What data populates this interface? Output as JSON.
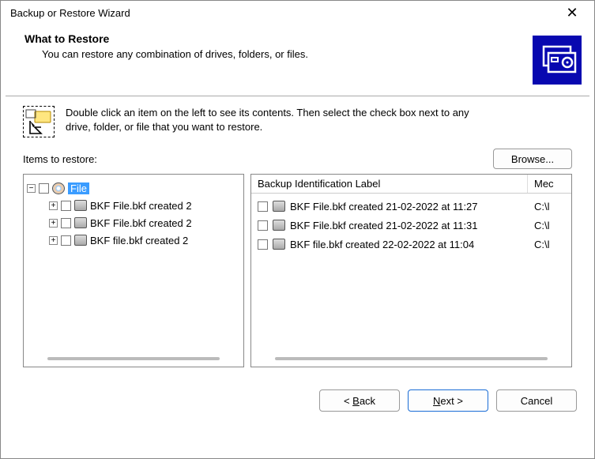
{
  "window": {
    "title": "Backup or Restore Wizard"
  },
  "header": {
    "title": "What to Restore",
    "subtitle": "You can restore any combination of drives, folders, or files."
  },
  "instruction": {
    "text": "Double click an item on the left to see its contents. Then select the check box next to any drive, folder, or file that you want to restore."
  },
  "items_label": "Items to restore:",
  "browse_label": "Browse...",
  "tree": {
    "root": {
      "label": "File",
      "expanded": true,
      "icon": "cd"
    },
    "children": [
      {
        "expand": "+",
        "label": "BKF File.bkf created 2"
      },
      {
        "expand": "+",
        "label": "BKF File.bkf created 2"
      },
      {
        "expand": "+",
        "label": "BKF file.bkf created 2"
      }
    ]
  },
  "list": {
    "columns": {
      "c1": "Backup Identification Label",
      "c2": "Mec"
    },
    "rows": [
      {
        "label": "BKF File.bkf created 21-02-2022 at 11:27",
        "loc": "C:\\l"
      },
      {
        "label": "BKF File.bkf created 21-02-2022 at 11:31",
        "loc": "C:\\l"
      },
      {
        "label": "BKF file.bkf created 22-02-2022 at 11:04",
        "loc": "C:\\l"
      }
    ]
  },
  "buttons": {
    "back": "< Back",
    "next": "Next >",
    "cancel": "Cancel"
  }
}
